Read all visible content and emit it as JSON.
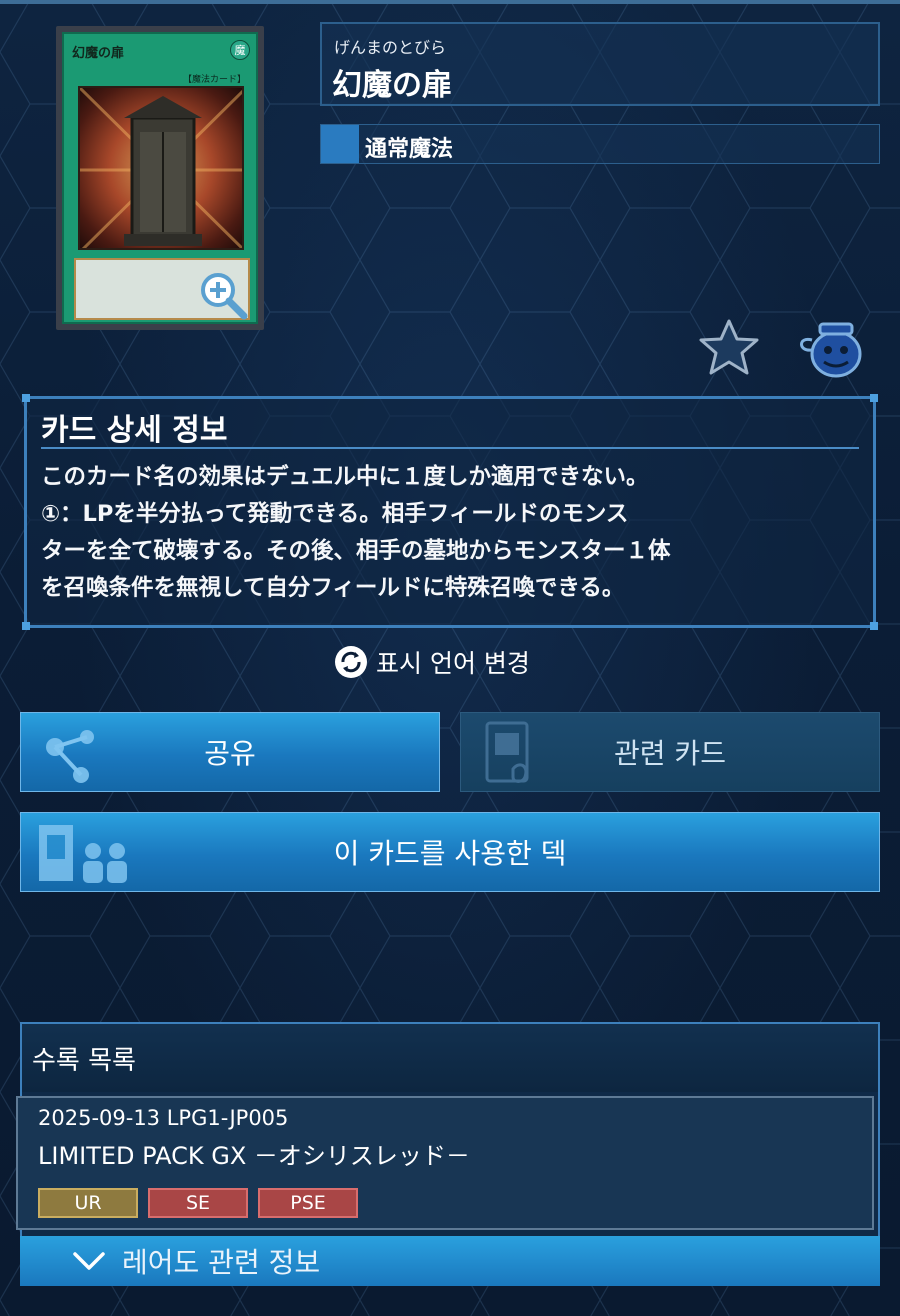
{
  "card": {
    "image_name": "幻魔の扉",
    "image_type_tag": "【魔法カード】",
    "image_attribute": "魔",
    "reading": "げんまのとびら",
    "name": "幻魔の扉",
    "type": "通常魔法"
  },
  "detail": {
    "heading": "카드 상세 정보",
    "text": "このカード名の効果はデュエル中に１度しか適用できない。\n①：LPを半分払って発動できる。相手フィールドのモンス\nターを全て破壊する。その後、相手の墓地からモンスター１体\nを召喚条件を無視して自分フィールドに特殊召喚できる。"
  },
  "language_toggle": {
    "label": "표시 언어 변경"
  },
  "buttons": {
    "share": "공유",
    "related": "관련 카드",
    "decks": "이 카드를 사용한 덱"
  },
  "release_list": {
    "title": "수록 목록",
    "entries": [
      {
        "date_code": "2025-09-13   LPG1-JP005",
        "pack": "LIMITED PACK GX －オシリスレッド－",
        "rarities": [
          "UR",
          "SE",
          "PSE"
        ]
      }
    ],
    "rarity_info_label": "레어도 관련 정보"
  },
  "colors": {
    "accent": "#2a90d0",
    "background": "#0b1d36",
    "rarity_ur": "#8e7a3f",
    "rarity_se": "#a94646"
  },
  "icons": [
    "zoom-icon",
    "star-icon",
    "pot-icon",
    "refresh-icon",
    "share-icon",
    "related-card-icon",
    "deck-icon",
    "chevron-down-icon"
  ]
}
